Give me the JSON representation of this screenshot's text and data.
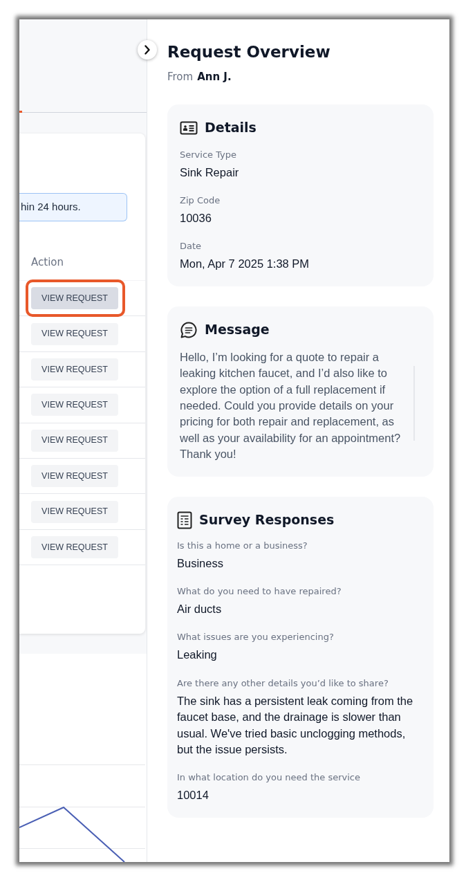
{
  "left_panel": {
    "notice": "hin 24 hours.",
    "table": {
      "columns": [
        "Action"
      ],
      "rows": [
        {
          "action": "VIEW REQUEST",
          "selected": true
        },
        {
          "action": "VIEW REQUEST",
          "selected": false
        },
        {
          "action": "VIEW REQUEST",
          "selected": false
        },
        {
          "action": "VIEW REQUEST",
          "selected": false
        },
        {
          "action": "VIEW REQUEST",
          "selected": false
        },
        {
          "action": "VIEW REQUEST",
          "selected": false
        },
        {
          "action": "VIEW REQUEST",
          "selected": false
        },
        {
          "action": "VIEW REQUEST",
          "selected": false
        }
      ]
    }
  },
  "drawer": {
    "title": "Request Overview",
    "from_label": "From",
    "from_name": "Ann J.",
    "sections": [
      {
        "kind": "details",
        "title": "Details",
        "fields": [
          {
            "label": "Service Type",
            "value": "Sink Repair"
          },
          {
            "label": "Zip Code",
            "value": "10036"
          },
          {
            "label": "Date",
            "value": "Mon, Apr 7 2025 1:38 PM"
          }
        ]
      },
      {
        "kind": "message",
        "title": "Message",
        "text": "Hello, I’m looking for a quote to repair a leaking kitchen faucet, and I’d also like to explore the option of a full replacement if needed. Could you provide details on your pricing for both repair and replacement, as well as your availability for an appointment? Thank you!"
      },
      {
        "kind": "survey",
        "title": "Survey Responses",
        "fields": [
          {
            "label": "Is this a home or a business?",
            "value": "Business"
          },
          {
            "label": "What do you need to have repaired?",
            "value": "Air ducts"
          },
          {
            "label": "What issues are you experiencing?",
            "value": "Leaking"
          },
          {
            "label": "Are there any other details you’d like to share?",
            "value": "The sink has a persistent leak coming from the faucet base, and the drainage is slower than usual. We've tried basic unclogging methods, but the issue persists."
          },
          {
            "label": "In what location do you need the service",
            "value": "10014"
          }
        ]
      }
    ]
  }
}
